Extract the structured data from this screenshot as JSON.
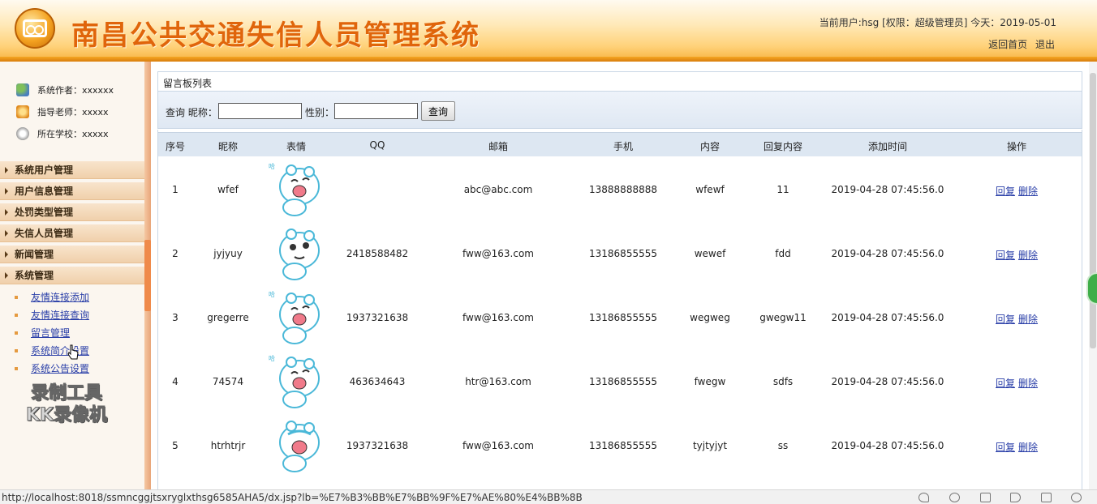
{
  "header": {
    "title": "南昌公共交通失信人员管理系统",
    "user_info": "当前用户:hsg [权限：超级管理员] 今天：2019-05-01",
    "links": [
      "返回首页",
      "退出"
    ]
  },
  "sidebar": {
    "info": [
      {
        "label": "系统作者：xxxxxx",
        "icon": "users-icon"
      },
      {
        "label": "指导老师：xxxxx",
        "icon": "teacher-icon"
      },
      {
        "label": "所在学校：xxxxx",
        "icon": "school-icon"
      }
    ],
    "menus": [
      "系统用户管理",
      "用户信息管理",
      "处罚类型管理",
      "失信人员管理",
      "新闻管理",
      "系统管理"
    ],
    "submenu": [
      "友情连接添加",
      "友情连接查询",
      "留言管理",
      "系统简介设置",
      "系统公告设置"
    ],
    "watermark": [
      "录制工具",
      "KK录像机"
    ]
  },
  "main": {
    "panel_title": "留言板列表",
    "search": {
      "prefix": "查询 昵称：",
      "gender_label": "性别：",
      "nickname_value": "",
      "gender_value": "",
      "button": "查询"
    },
    "columns": [
      "序号",
      "昵称",
      "表情",
      "QQ",
      "邮箱",
      "手机",
      "内容",
      "回复内容",
      "添加时间",
      "操作"
    ],
    "rows": [
      {
        "no": "1",
        "nickname": "wfef",
        "emoji": "laughing-bear",
        "qq": "",
        "email": "abc@abc.com",
        "phone": "13888888888",
        "content": "wfewf",
        "reply": "11",
        "time": "2019-04-28 07:45:56.0"
      },
      {
        "no": "2",
        "nickname": "jyjyuy",
        "emoji": "waving-bear",
        "qq": "2418588482",
        "email": "fww@163.com",
        "phone": "13186855555",
        "content": "wewef",
        "reply": "fdd",
        "time": "2019-04-28 07:45:56.0"
      },
      {
        "no": "3",
        "nickname": "gregerre",
        "emoji": "laughing-bear",
        "qq": "1937321638",
        "email": "fww@163.com",
        "phone": "13186855555",
        "content": "wegweg",
        "reply": "gwegw11",
        "time": "2019-04-28 07:45:56.0"
      },
      {
        "no": "4",
        "nickname": "74574",
        "emoji": "laughing-bear",
        "qq": "463634643",
        "email": "htr@163.com",
        "phone": "13186855555",
        "content": "fwegw",
        "reply": "sdfs",
        "time": "2019-04-28 07:45:56.0"
      },
      {
        "no": "5",
        "nickname": "htrhtrjr",
        "emoji": "crying-bear",
        "qq": "1937321638",
        "email": "fww@163.com",
        "phone": "13186855555",
        "content": "tyjtyjyt",
        "reply": "ss",
        "time": "2019-04-28 07:45:56.0"
      }
    ],
    "row_actions": [
      "回复",
      "删除"
    ]
  },
  "statusbar": {
    "url": "http://localhost:8018/ssmncggjtsxryglxthsg6585AHA5/dx.jsp?lb=%E7%B3%BB%E7%BB%9F%E7%AE%80%E4%BB%8B"
  },
  "colors": {
    "title": "#e0650b",
    "header_bar": "#f5a623",
    "link": "#2a3fa8",
    "table_header": "#dde7f2"
  }
}
